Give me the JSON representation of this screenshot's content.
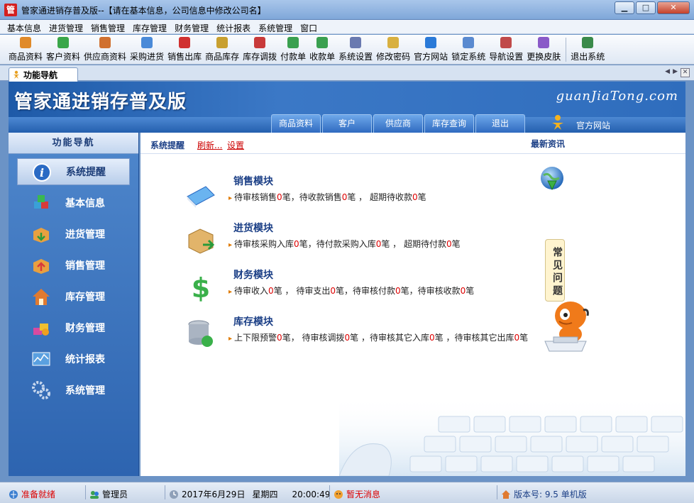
{
  "window": {
    "title": "管家通进销存普及版--【请在基本信息，公司信息中修改公司名】",
    "app_icon_glyph": "管",
    "minimize": "▁",
    "maximize": "□",
    "close": "✕"
  },
  "menu": [
    "基本信息",
    "进货管理",
    "销售管理",
    "库存管理",
    "财务管理",
    "统计报表",
    "系统管理",
    "窗口"
  ],
  "toolbar": [
    {
      "label": "商品资料",
      "icon": "goods-icon",
      "color": "#e08a2a"
    },
    {
      "label": "客户资料",
      "icon": "customer-icon",
      "color": "#3aa64a"
    },
    {
      "label": "供应商资料",
      "icon": "supplier-icon",
      "color": "#d07030"
    },
    {
      "label": "采购进货",
      "icon": "purchase-icon",
      "color": "#4a8ad8"
    },
    {
      "label": "销售出库",
      "icon": "sales-out-icon",
      "color": "#d03030"
    },
    {
      "label": "商品库存",
      "icon": "inventory-icon",
      "color": "#c8a030"
    },
    {
      "label": "库存调拨",
      "icon": "transfer-icon",
      "color": "#c83a3a"
    },
    {
      "label": "付款单",
      "icon": "payment-icon",
      "color": "#3aa050"
    },
    {
      "label": "收款单",
      "icon": "receipt-icon",
      "color": "#3aa050"
    },
    {
      "label": "系统设置",
      "icon": "settings-icon",
      "color": "#6a7ab0"
    },
    {
      "label": "修改密码",
      "icon": "password-icon",
      "color": "#d8b040"
    },
    {
      "label": "官方网站",
      "icon": "ie-icon",
      "color": "#2a7ad8"
    },
    {
      "label": "锁定系统",
      "icon": "lock-icon",
      "color": "#5a8ad0"
    },
    {
      "label": "导航设置",
      "icon": "nav-settings-icon",
      "color": "#c04a4a"
    },
    {
      "label": "更换皮肤",
      "icon": "skin-icon",
      "color": "#8a5ac8"
    },
    {
      "label": "退出系统",
      "icon": "exit-icon",
      "color": "#3a8a4a"
    }
  ],
  "tab": {
    "label": "功能导航"
  },
  "banner": {
    "title": "管家通进销存普及版",
    "site": "guanJiaTong.com",
    "tabs": [
      "商品资料",
      "客户",
      "供应商",
      "库存查询",
      "退出"
    ],
    "official_site": "官方网站"
  },
  "sidebar": {
    "header": "功能导航",
    "items": [
      {
        "label": "系统提醒",
        "icon": "info-icon",
        "active": true
      },
      {
        "label": "基本信息",
        "icon": "cubes-icon",
        "active": false
      },
      {
        "label": "进货管理",
        "icon": "box-in-icon",
        "active": false
      },
      {
        "label": "销售管理",
        "icon": "box-out-icon",
        "active": false
      },
      {
        "label": "库存管理",
        "icon": "house-icon",
        "active": false
      },
      {
        "label": "财务管理",
        "icon": "finance-icon",
        "active": false
      },
      {
        "label": "统计报表",
        "icon": "chart-icon",
        "active": false
      },
      {
        "label": "系统管理",
        "icon": "gears-icon",
        "active": false
      }
    ]
  },
  "main": {
    "alerts_label": "系统提醒",
    "refresh_label": "刷新...",
    "settings_label": "设置",
    "latest_news": "最新资讯",
    "faq": "常见问题",
    "modules": [
      {
        "title": "销售模块",
        "parts": [
          "待审核销售",
          "0",
          "笔，待收款销售",
          "0",
          "笔 ， 超期待收款",
          "0",
          "笔"
        ]
      },
      {
        "title": "进货模块",
        "parts": [
          "待审核采购入库",
          "0",
          "笔，待付款采购入库",
          "0",
          "笔 ， 超期待付款",
          "0",
          "笔"
        ]
      },
      {
        "title": "财务模块",
        "parts": [
          "待审收入",
          "0",
          "笔 ， 待审支出",
          "0",
          "笔，待审核付款",
          "0",
          "笔，待审核收款",
          "0",
          "笔"
        ]
      },
      {
        "title": "库存模块",
        "parts": [
          "上下限预警",
          "0",
          "笔， 待审核调拨",
          "0",
          "笔 ，待审核其它入库",
          "0",
          "笔 ，待审核其它出库",
          "0",
          "笔"
        ]
      }
    ]
  },
  "status": {
    "ready": "准备就绪",
    "user": "管理员",
    "date": "2017年6月29日",
    "weekday": "星期四",
    "time": "20:00:49",
    "message": "暂无消息",
    "version": "版本号: 9.5 单机版"
  }
}
